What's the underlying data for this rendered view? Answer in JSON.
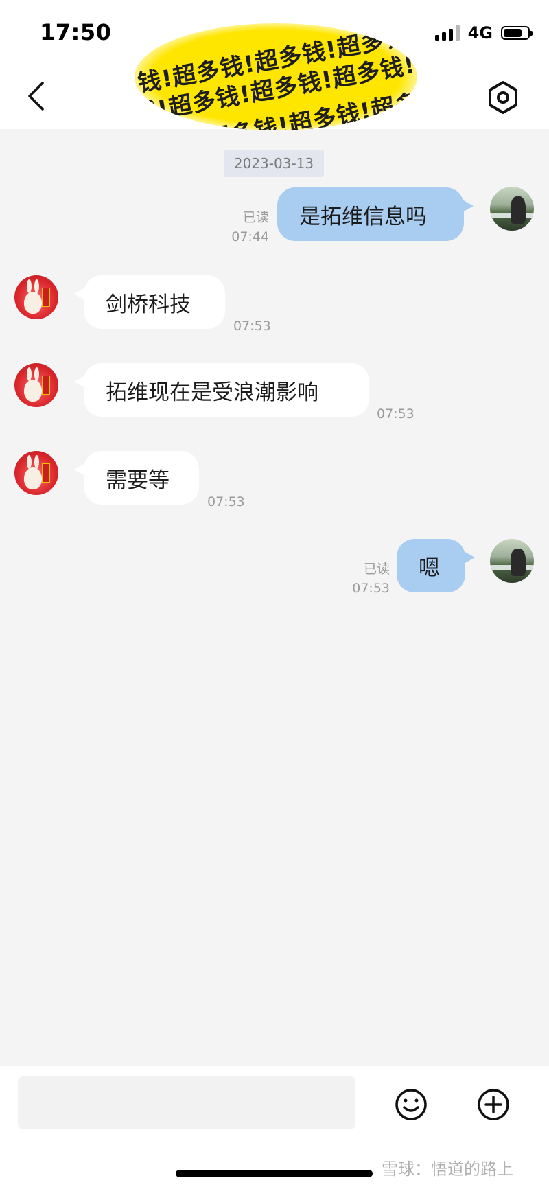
{
  "status_bar": {
    "time": "17:50",
    "network": "4G",
    "battery_level_pct": 75
  },
  "header": {
    "title_obscured_overlay_text": "钱!超多钱!超多钱!超多钱!超多钱!超多",
    "overlay_color": "#ffe600",
    "back_icon": "chevron-left-icon",
    "settings_icon": "settings-hexagon-icon"
  },
  "chat": {
    "date_separator": "2023-03-13",
    "messages": [
      {
        "direction": "out",
        "text": "是拓维信息吗",
        "read_label": "已读",
        "time": "07:44"
      },
      {
        "direction": "in",
        "text": "剑桥科技",
        "time": "07:53"
      },
      {
        "direction": "in",
        "text": "拓维现在是受浪潮影响",
        "time": "07:53"
      },
      {
        "direction": "in",
        "text": "需要等",
        "time": "07:53"
      },
      {
        "direction": "out",
        "text": "嗯",
        "read_label": "已读",
        "time": "07:53"
      }
    ]
  },
  "input_bar": {
    "placeholder": "",
    "emoji_icon": "smiley-icon",
    "plus_icon": "plus-circle-icon"
  },
  "watermark": "雪球：悟道的路上",
  "colors": {
    "outgoing_bubble": "#a9ccf1",
    "incoming_bubble": "#ffffff",
    "chat_background": "#f4f4f4"
  }
}
